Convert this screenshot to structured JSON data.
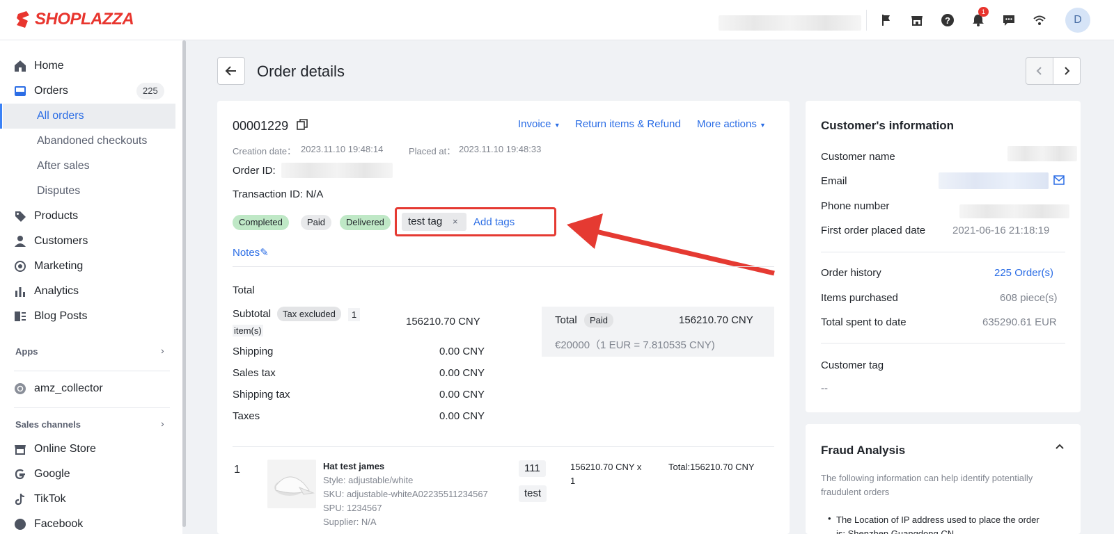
{
  "brand": {
    "name": "SHOPLAZZA",
    "color": "#e8352e"
  },
  "topbar": {
    "icons": [
      "flag-icon",
      "store-icon",
      "help-icon",
      "bell-icon",
      "chat-icon",
      "wifi-icon"
    ],
    "notification_count": "1",
    "avatar_initial": "D"
  },
  "sidebar": {
    "items": [
      {
        "label": "Home",
        "icon": "home-icon"
      },
      {
        "label": "Orders",
        "icon": "orders-icon",
        "count": "225"
      },
      {
        "label": "All orders"
      },
      {
        "label": "Abandoned checkouts"
      },
      {
        "label": "After sales"
      },
      {
        "label": "Disputes"
      },
      {
        "label": "Products",
        "icon": "tag-icon"
      },
      {
        "label": "Customers",
        "icon": "person-icon"
      },
      {
        "label": "Marketing",
        "icon": "marketing-icon"
      },
      {
        "label": "Analytics",
        "icon": "analytics-icon"
      },
      {
        "label": "Blog Posts",
        "icon": "blog-icon"
      }
    ],
    "apps_title": "Apps",
    "app_item": "amz_collector",
    "channels_title": "Sales channels",
    "channels": [
      {
        "label": "Online Store",
        "icon": "store-icon"
      },
      {
        "label": "Google",
        "icon": "google-icon"
      },
      {
        "label": "TikTok",
        "icon": "tiktok-icon"
      },
      {
        "label": "Facebook",
        "icon": "facebook-icon"
      }
    ]
  },
  "page": {
    "title": "Order details"
  },
  "order": {
    "number": "00001229",
    "actions": {
      "invoice": "Invoice",
      "refund": "Return items & Refund",
      "more": "More actions"
    },
    "creation_label": "Creation date：",
    "creation_value": "2023.11.10 19:48:14",
    "placed_label": "Placed at：",
    "placed_value": "2023.11.10 19:48:33",
    "order_id_label": "Order ID:",
    "transaction_label": "Transaction ID: N/A",
    "statuses": [
      "Completed",
      "Paid",
      "Delivered"
    ],
    "tag": "test tag",
    "tag_remove": "×",
    "add_tags": "Add tags",
    "notes": "Notes"
  },
  "totals": {
    "heading": "Total",
    "subtotal_label": "Subtotal",
    "tax_excluded": "Tax excluded",
    "items_count": "1",
    "items_suffix": "item(s)",
    "subtotal_value": "156210.70 CNY",
    "rows": [
      {
        "label": "Shipping",
        "value": "0.00 CNY"
      },
      {
        "label": "Sales tax",
        "value": "0.00 CNY"
      },
      {
        "label": "Shipping tax",
        "value": "0.00 CNY"
      },
      {
        "label": "Taxes",
        "value": "0.00 CNY"
      }
    ],
    "summary_label": "Total",
    "summary_status": "Paid",
    "summary_value": "156210.70 CNY",
    "summary_conversion": "€20000（1 EUR = 7.810535 CNY)"
  },
  "line_item": {
    "index": "1",
    "name": "Hat test james",
    "style": "Style: adjustable/white",
    "sku": "SKU: adjustable-whiteA02235511234567",
    "spu": "SPU: 1234567",
    "supplier": "Supplier: N/A",
    "tags": [
      "111",
      "test"
    ],
    "price_line1": "156210.70 CNY x",
    "price_line2": "1",
    "total": "Total:156210.70 CNY"
  },
  "customer": {
    "heading": "Customer's information",
    "name_label": "Customer name",
    "email_label": "Email",
    "phone_label": "Phone number",
    "first_order_label": "First order placed date",
    "first_order_value": "2021-06-16 21:18:19",
    "history_label": "Order history",
    "history_value": "225 Order(s)",
    "items_label": "Items purchased",
    "items_value": "608 piece(s)",
    "spent_label": "Total spent to date",
    "spent_value": "635290.61 EUR",
    "tag_label": "Customer tag",
    "tag_value": "--"
  },
  "fraud": {
    "heading": "Fraud Analysis",
    "description_1": "The following information can help identify potentially",
    "description_2": "fraudulent orders",
    "bullet_1": "The Location of IP address used to place the order",
    "bullet_2": "is: Shenzhen Guangdong CN"
  }
}
